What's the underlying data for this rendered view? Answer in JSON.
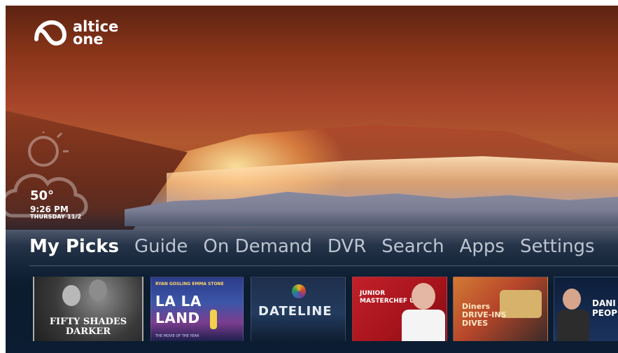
{
  "brand": {
    "line1": "altice",
    "line2": "one"
  },
  "weather": {
    "temperature": "50°",
    "time": "9:26 PM",
    "date": "THURSDAY 11/2"
  },
  "nav": [
    {
      "label": "My Picks",
      "active": true
    },
    {
      "label": "Guide"
    },
    {
      "label": "On Demand"
    },
    {
      "label": "DVR"
    },
    {
      "label": "Search"
    },
    {
      "label": "Apps"
    },
    {
      "label": "Settings"
    }
  ],
  "tiles": {
    "t1": {
      "title": "FIFTY SHADES\nDARKER"
    },
    "t2": {
      "cast": "RYAN GOSLING   EMMA STONE",
      "title": "LA LA LAND",
      "tagline": "THE MOVIE OF THE YEAR"
    },
    "t3": {
      "title": "DATELINE"
    },
    "t4": {
      "title": "JUNIOR\nMASTERCHEF USA"
    },
    "t5": {
      "title": "Diners\nDRIVE-INS\nDIVES"
    },
    "t6": {
      "title": "DANI\nPEOPLE"
    }
  },
  "colors": {
    "accent": "#ffffff",
    "panel": "#0b1d32"
  }
}
